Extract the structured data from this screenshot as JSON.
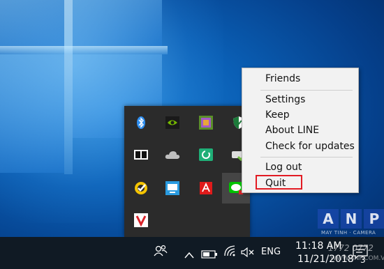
{
  "context_menu": {
    "items": [
      {
        "label": "Friends"
      },
      {
        "label": "Settings"
      },
      {
        "label": "Keep"
      },
      {
        "label": "About LINE"
      },
      {
        "label": "Check for updates"
      },
      {
        "label": "Log out"
      },
      {
        "label": "Quit"
      }
    ],
    "highlight_color": "#e21b23"
  },
  "tray_icons": [
    {
      "name": "bluetooth-icon",
      "color": "#2e8ef0"
    },
    {
      "name": "nvidia-icon",
      "color": "#76b900"
    },
    {
      "name": "graphics-icon",
      "color": "#a45ac8"
    },
    {
      "name": "security-shield-icon",
      "color": "#ffffff"
    },
    {
      "name": "dolby-icon",
      "color": "#ffffff"
    },
    {
      "name": "onedrive-icon",
      "color": "#bfbfbf"
    },
    {
      "name": "sync-app-icon",
      "color": "#1faf77"
    },
    {
      "name": "drive-check-icon",
      "color": "#6dbb3b"
    },
    {
      "name": "norton-icon",
      "color": "#f5c400"
    },
    {
      "name": "screen-app-icon",
      "color": "#2a9be0"
    },
    {
      "name": "adobe-icon",
      "color": "#e01b1b"
    },
    {
      "name": "line-icon",
      "color": "#00c300"
    },
    {
      "name": "vsee-icon",
      "color": "#d9232a"
    }
  ],
  "taskbar": {
    "language": "ENG",
    "time": "11:18 AM",
    "date": "11/21/2018",
    "notification_count": "3",
    "background": "#101a24"
  },
  "watermark": {
    "letters": [
      "A",
      "N",
      "P"
    ],
    "subtitle": "MAY TINH · CAMERA",
    "phone": "1772 0772",
    "url": "WWW.ANP.COM.VN"
  }
}
